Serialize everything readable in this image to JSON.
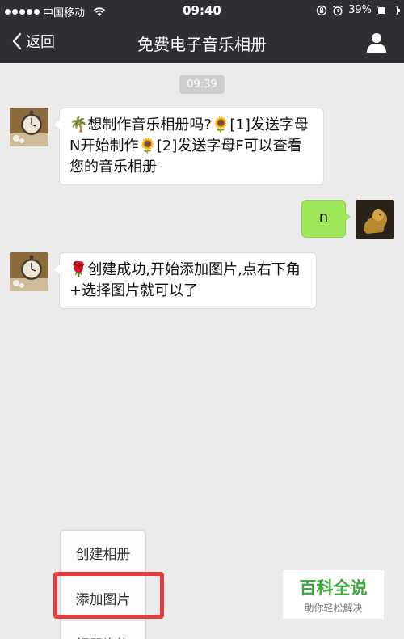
{
  "status_bar": {
    "carrier": "中国移动",
    "time": "09:40",
    "battery": "39%",
    "battery_level": 0.39
  },
  "nav": {
    "back_label": "返回",
    "title": "免费电子音乐相册"
  },
  "chat": {
    "timestamp": "09:39",
    "messages": [
      {
        "side": "left",
        "text": "🌴想制作音乐相册吗?🌻[1]发送字母N开始制作🌻[2]发送字母F可以查看您的音乐相册"
      },
      {
        "side": "right",
        "text": "n"
      },
      {
        "side": "left",
        "text": "🌹创建成功,开始添加图片,点右下角+选择图片就可以了"
      }
    ]
  },
  "menu": {
    "items": [
      "创建相册",
      "添加图片",
      "相册咨询"
    ]
  },
  "watermark": {
    "title": "百科全说",
    "subtitle": "助你轻松解决"
  },
  "colors": {
    "nav_bg": "#2e2e33",
    "chat_bg": "#ebebeb",
    "right_bubble": "#a0e75a",
    "highlight": "#e23c3c",
    "watermark_green": "#3aa93a"
  }
}
